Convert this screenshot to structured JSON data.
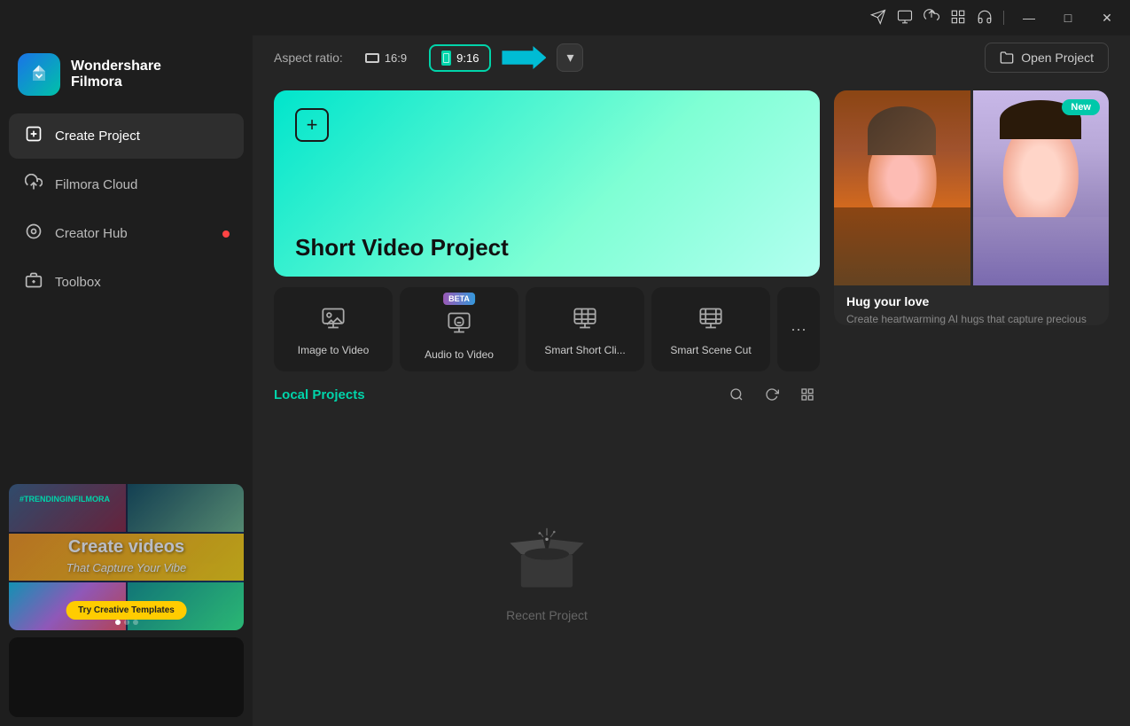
{
  "app": {
    "name": "Wondershare",
    "name2": "Filmora"
  },
  "titlebar": {
    "minimize": "—",
    "maximize": "□",
    "close": "✕",
    "icons": [
      "send-icon",
      "cloud-download-icon",
      "upload-icon",
      "grid-icon",
      "headset-icon"
    ]
  },
  "topbar": {
    "aspect_label": "Aspect ratio:",
    "ratio_16_9": "16:9",
    "ratio_9_16": "9:16",
    "open_project": "Open Project"
  },
  "sidebar": {
    "nav_items": [
      {
        "id": "create-project",
        "label": "Create Project",
        "icon": "➕",
        "active": true,
        "dot": false
      },
      {
        "id": "filmora-cloud",
        "label": "Filmora Cloud",
        "icon": "☁",
        "active": false,
        "dot": false
      },
      {
        "id": "creator-hub",
        "label": "Creator Hub",
        "icon": "◎",
        "active": false,
        "dot": true
      },
      {
        "id": "toolbox",
        "label": "Toolbox",
        "icon": "🧰",
        "active": false,
        "dot": false
      }
    ],
    "thumbnail1": {
      "hashtag": "#TRENDINGINFILMORA",
      "title": "Create videos",
      "subtitle": "That Capture Your Vibe",
      "cta": "Try Creative Templates",
      "dots": [
        true,
        false,
        false
      ]
    },
    "thumbnail2": {
      "bg": "#111"
    }
  },
  "main": {
    "short_video_project": {
      "title": "Short Video Project",
      "plus_icon": "⊕"
    },
    "ai_tools": [
      {
        "id": "image-to-video",
        "label": "Image to Video",
        "icon": "🎬",
        "beta": false
      },
      {
        "id": "audio-to-video",
        "label": "Audio to Video",
        "icon": "🎵",
        "beta": true
      },
      {
        "id": "smart-short-clip",
        "label": "Smart Short Cli...",
        "icon": "✂",
        "beta": false
      },
      {
        "id": "smart-scene-cut",
        "label": "Smart Scene Cut",
        "icon": "🎞",
        "beta": false
      }
    ],
    "more_label": "•••",
    "local_projects": {
      "title": "Local Projects",
      "empty_text": "Recent Project"
    }
  },
  "promo": {
    "new_badge": "New",
    "title": "Hug your love",
    "desc": "Create heartwarming AI hugs that capture precious moments...",
    "dots": [
      true,
      false,
      false,
      false,
      false,
      false
    ]
  }
}
